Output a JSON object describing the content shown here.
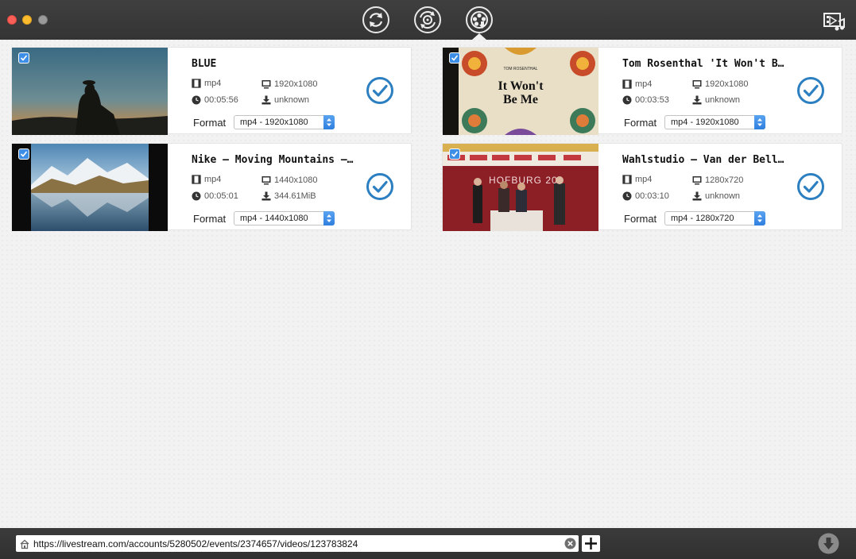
{
  "window": {
    "toolbar_modes": [
      {
        "name": "convert",
        "icon": "convert-icon"
      },
      {
        "name": "burn",
        "icon": "burn-icon"
      },
      {
        "name": "download",
        "icon": "film-reel-download-icon",
        "active": true
      }
    ],
    "library_icon": "media-library-icon"
  },
  "labels": {
    "format": "Format"
  },
  "videos": [
    {
      "title": "BLUE",
      "container": "mp4",
      "resolution": "1920x1080",
      "duration": "00:05:56",
      "size": "unknown",
      "format": "mp4 - 1920x1080",
      "checked": true,
      "done": true
    },
    {
      "title": "Tom Rosenthal 'It Won't Be…",
      "container": "mp4",
      "resolution": "1920x1080",
      "duration": "00:03:53",
      "size": "unknown",
      "format": "mp4 - 1920x1080",
      "checked": true,
      "done": true
    },
    {
      "title": "Nike – Moving Mountains –…",
      "container": "mp4",
      "resolution": "1440x1080",
      "duration": "00:05:01",
      "size": "344.61MiB",
      "format": "mp4 - 1440x1080",
      "checked": true,
      "done": true
    },
    {
      "title": "Wahlstudio – Van der Belle…",
      "container": "mp4",
      "resolution": "1280x720",
      "duration": "00:03:10",
      "size": "unknown",
      "format": "mp4 - 1280x720",
      "checked": true,
      "done": true
    }
  ],
  "thumb_texts": {
    "rosenthal_artist": "TOM ROSENTHAL",
    "rosenthal_line1": "It Won't",
    "rosenthal_line2": "Be Me",
    "hofburg": "HOFBURG 20"
  },
  "url_bar": {
    "value": "https://livestream.com/accounts/5280502/events/2374657/videos/123783824"
  },
  "colors": {
    "accent": "#2c7fc0",
    "checkbox": "#3d8ee6",
    "titlebar": "#3a3a3a"
  }
}
